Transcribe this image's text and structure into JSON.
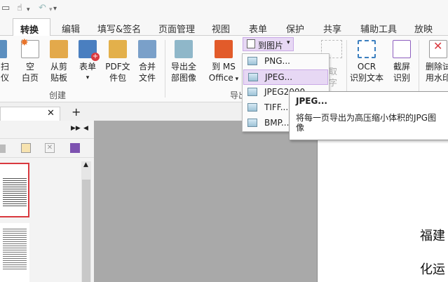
{
  "ribbon_tabs": [
    "转换",
    "编辑",
    "填写&签名",
    "页面管理",
    "视图",
    "表单",
    "保护",
    "共享",
    "辅助工具",
    "放映"
  ],
  "active_tab": "转换",
  "ribbon": {
    "btn_partial_left_l1": "扫",
    "btn_partial_left_l2": "仪",
    "blank_page_l1": "空",
    "blank_page_l2": "白页",
    "from_clip_l1": "从剪",
    "from_clip_l2": "贴板",
    "form": "表单",
    "pdf_pkg_l1": "PDF文",
    "pdf_pkg_l2": "件包",
    "merge_l1": "合并",
    "merge_l2": "文件",
    "export_all_l1": "导出全",
    "export_all_l2": "部图像",
    "to_ms_l1": "到 MS",
    "to_ms_l2": "Office",
    "to_image": "到图片",
    "ocr_l1": "OCR",
    "ocr_l2": "识别文本",
    "screenshot_l1": "截屏",
    "screenshot_l2": "识别",
    "delete_l1": "删除试",
    "delete_l2": "用水印",
    "group_create": "创建",
    "group_export": "导出",
    "ocr_partial_1": "取",
    "ocr_partial_2": "字"
  },
  "dropdown": {
    "items": [
      "PNG...",
      "JPEG...",
      "JPEG2000...",
      "TIFF...",
      "BMP..."
    ],
    "highlighted_index": 1
  },
  "tooltip": {
    "title": "JPEG...",
    "text": "将每一页导出为高压缩小体积的JPG图像"
  },
  "doc": {
    "text_1": "福建",
    "text_2": "化运"
  },
  "icons": [
    "cursor-icon",
    "undo-icon",
    "redo-icon",
    "customize-qat-icon",
    "close-tab-icon",
    "new-tab-icon",
    "scroll-up-icon"
  ]
}
